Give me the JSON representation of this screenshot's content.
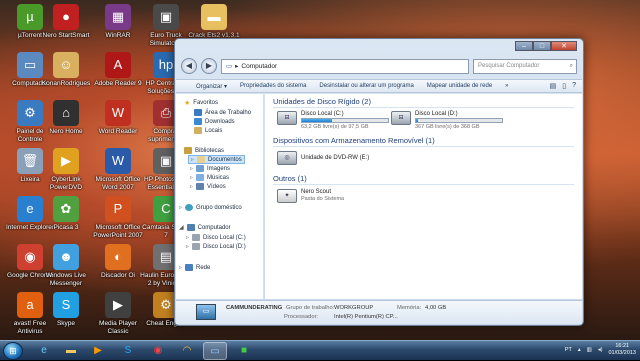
{
  "desktop": {
    "icons": [
      {
        "label": "µTorrent",
        "icon": "utorrent-icon",
        "color": "#4a9a2a",
        "glyph": "µ"
      },
      {
        "label": "Nero StartSmart",
        "icon": "nero-icon",
        "color": "#c02020",
        "glyph": "●"
      },
      {
        "label": "WinRAR",
        "icon": "winrar-icon",
        "color": "#7a3a8a",
        "glyph": "▦"
      },
      {
        "label": "Euro Truck Simulator 2",
        "icon": "truck-icon",
        "color": "#4a4a4a",
        "glyph": "▣"
      },
      {
        "label": "Crack Ets2 v1.3.1",
        "icon": "folder-icon",
        "color": "#e8c060",
        "glyph": "▬"
      },
      {
        "label": "Computador",
        "icon": "computer-icon",
        "color": "#5a8ac0",
        "glyph": "▭"
      },
      {
        "label": "KonanRodrigues",
        "icon": "user-folder-icon",
        "color": "#d8b060",
        "glyph": "☺"
      },
      {
        "label": "Adobe Reader 9",
        "icon": "adobe-reader-icon",
        "color": "#b01818",
        "glyph": "A"
      },
      {
        "label": "HP Central de Soluções HP",
        "icon": "hp-icon",
        "color": "#2a6ab0",
        "glyph": "hp"
      },
      {
        "label": "Painel de Controle",
        "icon": "control-panel-icon",
        "color": "#3a7ac0",
        "glyph": "⚙"
      },
      {
        "label": "Nero Home",
        "icon": "nero-home-icon",
        "color": "#303030",
        "glyph": "⌂"
      },
      {
        "label": "Word Reader",
        "icon": "word-reader-icon",
        "color": "#c03020",
        "glyph": "W"
      },
      {
        "label": "Comprar suprimentos",
        "icon": "printer-icon",
        "color": "#a03030",
        "glyph": "⎙"
      },
      {
        "label": "Lixeira",
        "icon": "recycle-bin-icon",
        "color": "#8aa0b8",
        "glyph": "🗑"
      },
      {
        "label": "CyberLink PowerDVD",
        "icon": "powerdvd-icon",
        "color": "#e0a020",
        "glyph": "▶"
      },
      {
        "label": "Microsoft Office Word 2007",
        "icon": "word-icon",
        "color": "#2a5aa8",
        "glyph": "W"
      },
      {
        "label": "HP Photosmart Essential 2.5",
        "icon": "hp-photosmart-icon",
        "color": "#606060",
        "glyph": "▣"
      },
      {
        "label": "Internet Explorer",
        "icon": "internet-explorer-icon",
        "color": "#2a80d0",
        "glyph": "e"
      },
      {
        "label": "Picasa 3",
        "icon": "picasa-icon",
        "color": "#50a040",
        "glyph": "✿"
      },
      {
        "label": "Microsoft Office PowerPoint 2007",
        "icon": "powerpoint-icon",
        "color": "#d05020",
        "glyph": "P"
      },
      {
        "label": "Camtasia Studio 7",
        "icon": "camtasia-icon",
        "color": "#40a040",
        "glyph": "C"
      },
      {
        "label": "Google Chrome",
        "icon": "chrome-icon",
        "color": "#d04030",
        "glyph": "◉"
      },
      {
        "label": "Windows Live Messenger",
        "icon": "messenger-icon",
        "color": "#40a0e0",
        "glyph": "☻"
      },
      {
        "label": "Discador Oi",
        "icon": "oi-dialer-icon",
        "color": "#e07020",
        "glyph": "◐"
      },
      {
        "label": "Haulin Euro Truck 2 by Vinicius",
        "icon": "haulin-icon",
        "color": "#707070",
        "glyph": "▤"
      },
      {
        "label": "avast! Free Antivirus",
        "icon": "avast-icon",
        "color": "#e06010",
        "glyph": "a"
      },
      {
        "label": "Skype",
        "icon": "skype-icon",
        "color": "#20a0e0",
        "glyph": "S"
      },
      {
        "label": "Media Player Classic",
        "icon": "media-player-icon",
        "color": "#404040",
        "glyph": "▶"
      },
      {
        "label": "Cheat Engine",
        "icon": "cheat-engine-icon",
        "color": "#c08020",
        "glyph": "⚙"
      }
    ]
  },
  "window": {
    "address": "Computador",
    "search_placeholder": "Pesquisar Computador",
    "toolbar": {
      "organize": "Organizar ▾",
      "system_props": "Propriedades do sistema",
      "uninstall": "Desinstalar ou alterar um programa",
      "map_drive": "Mapear unidade de rede",
      "more": "»"
    },
    "nav": {
      "favorites": "Favoritos",
      "desktop": "Área de Trabalho",
      "downloads": "Downloads",
      "recent": "Locais",
      "libraries": "Bibliotecas",
      "documents": "Documentos",
      "images": "Imagens",
      "music": "Músicas",
      "videos": "Vídeos",
      "homegroup": "Grupo doméstico",
      "computer": "Computador",
      "disk_c": "Disco Local (C:)",
      "disk_d": "Disco Local (D:)",
      "network": "Rede"
    },
    "groups": {
      "hard_disks": "Unidades de Disco Rígido (2)",
      "removable": "Dispositivos com Armazenamento Removível (1)",
      "others": "Outros (1)"
    },
    "drives": [
      {
        "name": "Disco Local (C:)",
        "free": "63,2 GB livre(s) de 97,5 GB",
        "used_fraction": 0.35
      },
      {
        "name": "Disco Local (D:)",
        "free": "367 GB livre(s) de 368 GB",
        "used_fraction": 0.01
      }
    ],
    "dvd": {
      "name": "Unidade de DVD-RW (E:)"
    },
    "other": {
      "name": "Nero Scout",
      "sub": "Pasta do Sistema"
    },
    "details": {
      "pc_name": "CAMMUNDERATING",
      "workgroup_label": "Grupo de trabalho:",
      "workgroup": "WORKGROUP",
      "memory_label": "Memória:",
      "memory": "4,00 GB",
      "processor_label": "Processador:",
      "processor": "Intel(R) Pentium(R) CP..."
    }
  },
  "taskbar": {
    "language": "PT",
    "time": "16:21",
    "date": "01/03/2013"
  }
}
